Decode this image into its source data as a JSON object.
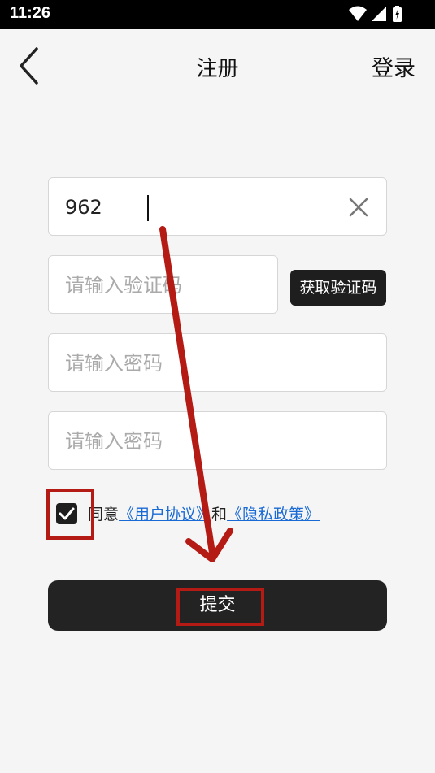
{
  "status_bar": {
    "time": "11:26",
    "icons": [
      "wifi-icon",
      "signal-icon",
      "battery-charging-icon"
    ]
  },
  "header": {
    "back_icon": "chevron-left-icon",
    "title": "注册",
    "login_label": "登录"
  },
  "form": {
    "phone_value": "962",
    "clear_icon": "close-icon",
    "code_placeholder": "请输入验证码",
    "get_code_label": "获取验证码",
    "password_placeholder": "请输入密码",
    "confirm_password_placeholder": "请输入密码"
  },
  "agreement": {
    "checked": true,
    "prefix": "同意",
    "user_agreement": "《用户协议》",
    "conjunction": "和",
    "privacy_policy": "《隐私政策》"
  },
  "submit_label": "提交",
  "annotation": {
    "color": "#b31b14"
  }
}
